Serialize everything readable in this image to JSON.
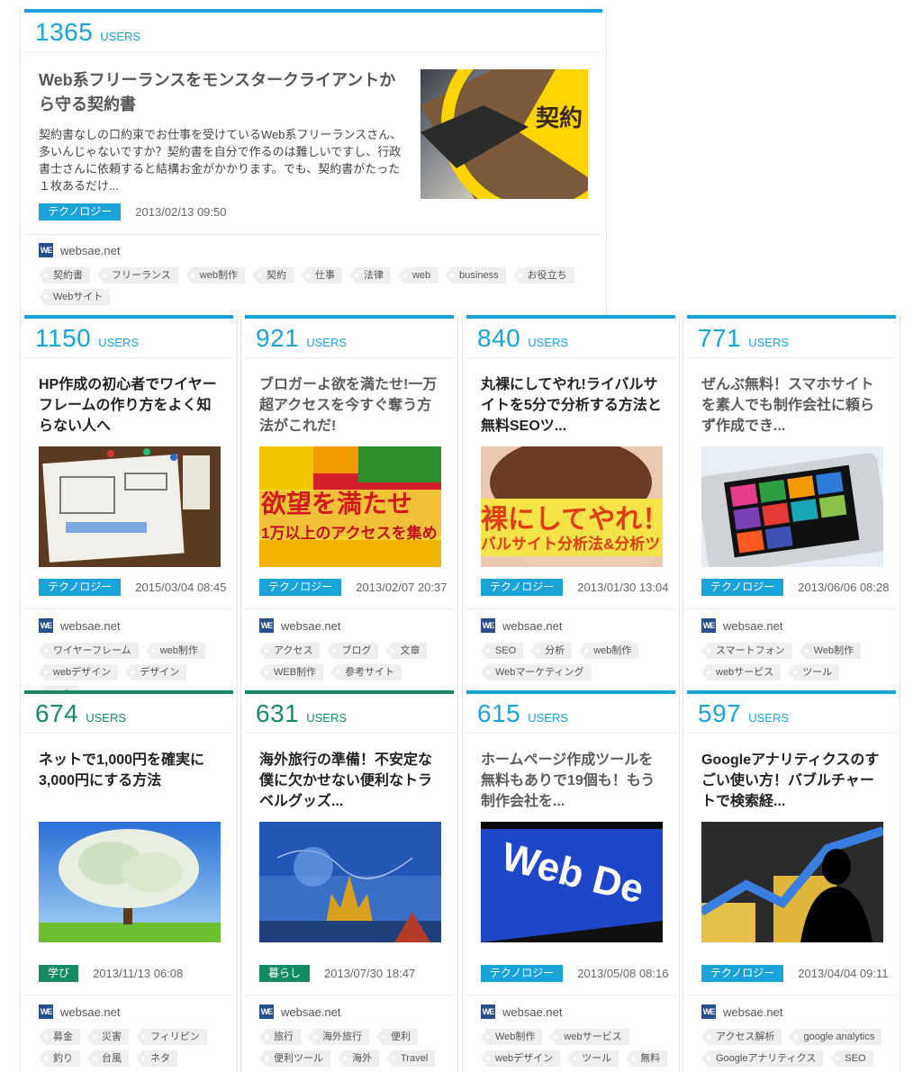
{
  "users_label": "USERS",
  "site_icon_text": "WE",
  "featured": {
    "count": "1365",
    "title": "Web系フリーランスをモンスタークライアントから守る契約書",
    "excerpt": "契約書なしの口約束でお仕事を受けているWeb系フリーランスさん、多いんじゃないですか？契約書を自分で作るのは難しいですし、行政書士さんに依頼すると結構お金がかかります。でも、契約書がたった１枚あるだけ...",
    "category": "テクノロジー",
    "date": "2013/02/13 09:50",
    "site": "websae.net",
    "image_text": "契約",
    "tags": [
      "契約書",
      "フリーランス",
      "web制作",
      "契約",
      "仕事",
      "法律",
      "web",
      "business",
      "お役立ち",
      "Webサイト"
    ]
  },
  "cards": [
    {
      "count": "1150",
      "title": "HP作成の初心者でワイヤーフレームの作り方をよく知らない人へ",
      "category": "テクノロジー",
      "date": "2015/03/04 08:45",
      "site": "websae.net",
      "tags": [
        "ワイヤーフレーム",
        "web制作",
        "webデザイン",
        "デザイン",
        "web"
      ]
    },
    {
      "count": "921",
      "title": "ブロガーよ欲を満たせ!一万超アクセスを今すぐ奪う方法がこれだ!",
      "category": "テクノロジー",
      "date": "2013/02/07 20:37",
      "site": "websae.net",
      "image_line1": "欲望を満たせ",
      "image_line2": "1万以上のアクセスを集め",
      "tags": [
        "アクセス",
        "ブログ",
        "文章",
        "WEB制作",
        "参考サイト"
      ]
    },
    {
      "count": "840",
      "title": "丸裸にしてやれ!ライバルサイトを5分で分析する方法と無料SEOツ...",
      "category": "テクノロジー",
      "date": "2013/01/30 13:04",
      "site": "websae.net",
      "image_line1": "裸にしてやれ！",
      "image_line2": "バルサイト分析法&分析ツ",
      "tags": [
        "SEO",
        "分析",
        "web制作",
        "Webマーケティング"
      ]
    },
    {
      "count": "771",
      "title": "ぜんぶ無料！スマホサイトを素人でも制作会社に頼らず作成でき...",
      "category": "テクノロジー",
      "date": "2013/06/06 08:28",
      "site": "websae.net",
      "tags": [
        "スマートフォン",
        "Web制作",
        "webサービス",
        "ツール"
      ]
    },
    {
      "count": "674",
      "title": "ネットで1,000円を確実に3,000円にする方法",
      "category": "学び",
      "date": "2013/11/13 06:08",
      "site": "websae.net",
      "tags": [
        "募金",
        "災害",
        "フィリピン",
        "釣り",
        "台風",
        "ネタ"
      ]
    },
    {
      "count": "631",
      "title": "海外旅行の準備！不安定な僕に欠かせない便利なトラベルグッズ...",
      "category": "暮らし",
      "date": "2013/07/30 18:47",
      "site": "websae.net",
      "tags": [
        "旅行",
        "海外旅行",
        "便利",
        "便利ツール",
        "海外",
        "Travel"
      ]
    },
    {
      "count": "615",
      "title": "ホームページ作成ツールを無料もありで19個も！もう制作会社を...",
      "category": "テクノロジー",
      "date": "2013/05/08 08:16",
      "site": "websae.net",
      "image_line1": "Web De",
      "tags": [
        "Web制作",
        "webサービス",
        "webデザイン",
        "ツール",
        "無料"
      ]
    },
    {
      "count": "597",
      "title": "Googleアナリティクスのすごい使い方！バブルチャートで検索経...",
      "category": "テクノロジー",
      "date": "2013/04/04 09:11",
      "site": "websae.net",
      "tags": [
        "アクセス解析",
        "google analytics",
        "Googleアナリティクス",
        "SEO"
      ]
    }
  ]
}
